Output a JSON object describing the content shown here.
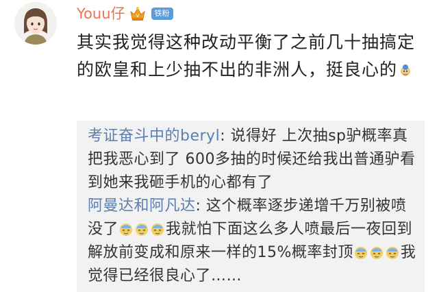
{
  "comment": {
    "username": "Youu仔",
    "badge": "铁粉",
    "avatar_icon": "cartoon-girl-avatar",
    "vip_icon": "vip-crown-icon",
    "text": "其实我觉得这种改动平衡了之前几十抽搞定的欧皇和上少抽不出的非洲人，挺良心的",
    "trailing_emoji": "doge-emoji"
  },
  "replies": [
    {
      "user": "考证奋斗中的beryl",
      "separator": ": ",
      "text": "说得好 上次抽sp驴概率真把我恶心到了 600多抽的时候还给我出普通驴看到她来我砸手机的心都有了"
    },
    {
      "user": "阿曼达和阿凡达",
      "separator": ": ",
      "text_part1": "这个概率逐步递增千万别被喷没了",
      "emoji_1": "fainting-face-emoji",
      "text_part2": "我就怕下面这么多人喷最后一夜回到解放前变成和原来一样的15%概率封顶",
      "emoji_2": "fainting-face-emoji",
      "text_part3": "我觉得已经很良心了……"
    }
  ],
  "colors": {
    "username": "#eb7350",
    "reply_user": "#5b7fb0",
    "badge_bg": "#5f9bd6",
    "reply_bg": "#f2f2f2"
  }
}
